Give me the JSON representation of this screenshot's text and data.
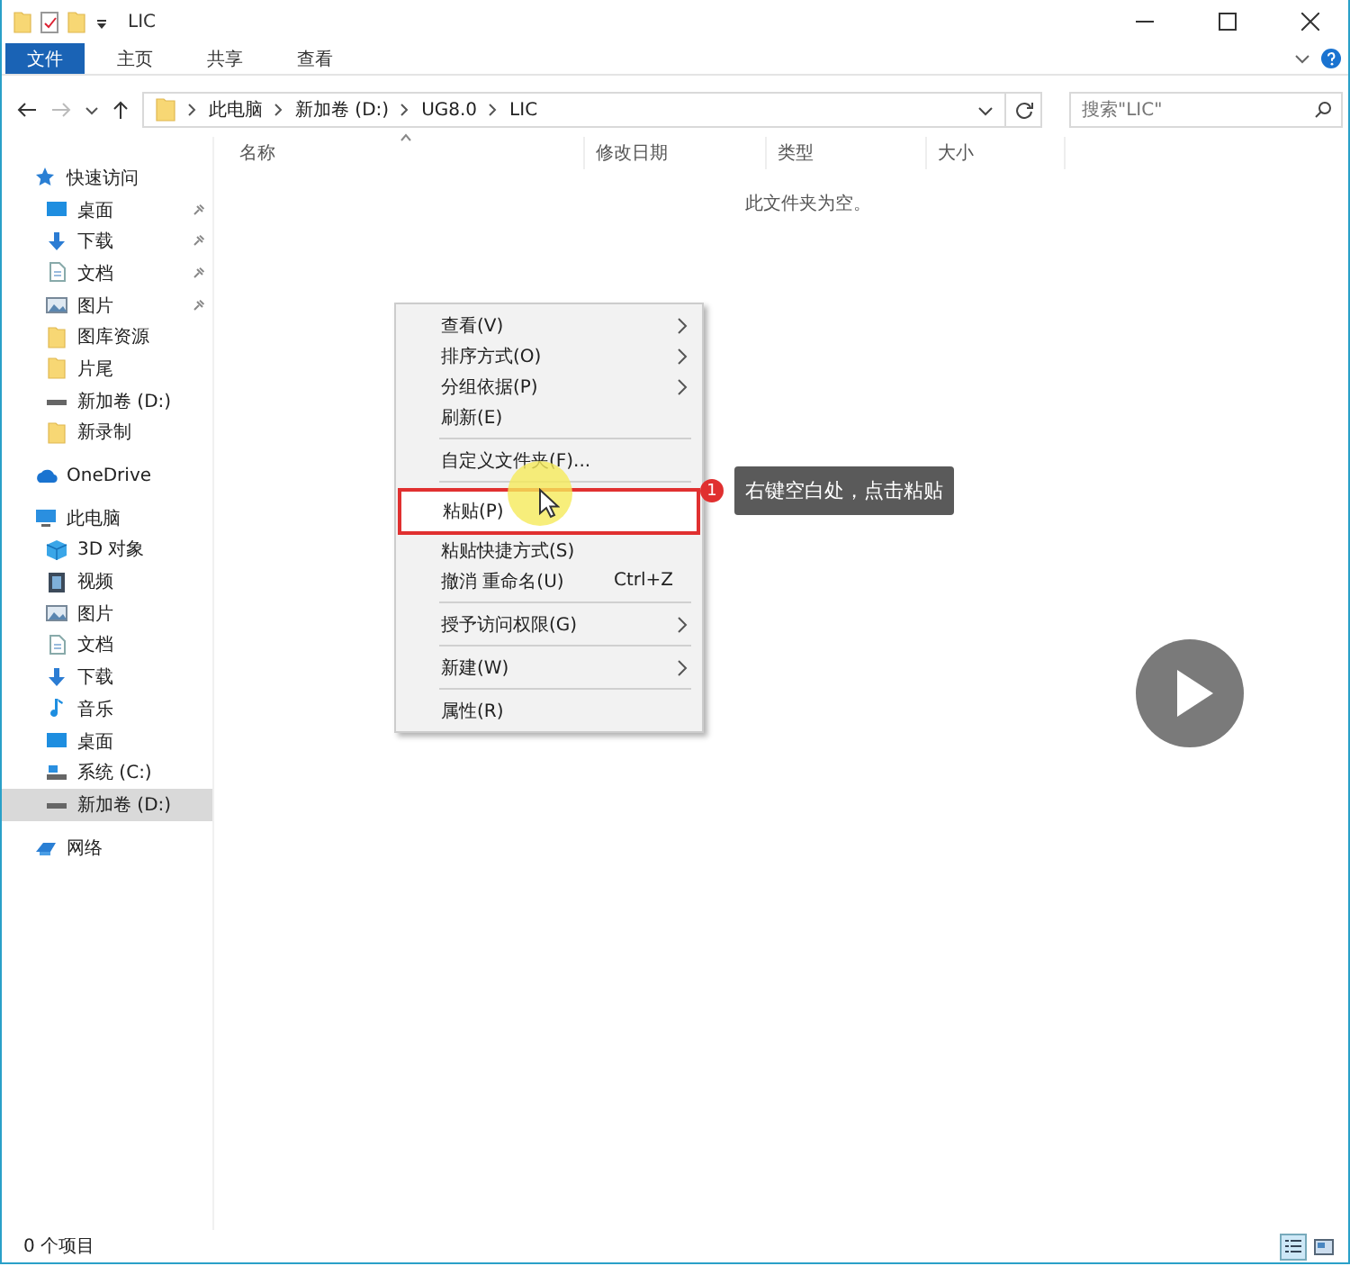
{
  "window": {
    "title": "LIC"
  },
  "ribbon": {
    "tabs": [
      {
        "label": "文件",
        "selected": true
      },
      {
        "label": "主页",
        "selected": false
      },
      {
        "label": "共享",
        "selected": false
      },
      {
        "label": "查看",
        "selected": false
      }
    ]
  },
  "address": {
    "segments": [
      "此电脑",
      "新加卷 (D:)",
      "UG8.0",
      "LIC"
    ]
  },
  "search": {
    "placeholder": "搜索\"LIC\""
  },
  "columns": [
    "名称",
    "修改日期",
    "类型",
    "大小"
  ],
  "empty_message": "此文件夹为空。",
  "sidebar": {
    "groups": [
      {
        "label": "快速访问",
        "kind": "star",
        "children": [
          {
            "label": "桌面",
            "kind": "desktop",
            "pinned": true,
            "selected": false
          },
          {
            "label": "下载",
            "kind": "download",
            "pinned": true,
            "selected": false
          },
          {
            "label": "文档",
            "kind": "document",
            "pinned": true,
            "selected": false
          },
          {
            "label": "图片",
            "kind": "pictures",
            "pinned": true,
            "selected": false
          },
          {
            "label": "图库资源",
            "kind": "folder",
            "pinned": false,
            "selected": false
          },
          {
            "label": "片尾",
            "kind": "folder",
            "pinned": false,
            "selected": false
          },
          {
            "label": "新加卷 (D:)",
            "kind": "drive",
            "pinned": false,
            "selected": false
          },
          {
            "label": "新录制",
            "kind": "folder",
            "pinned": false,
            "selected": false
          }
        ]
      },
      {
        "label": "OneDrive",
        "kind": "cloud"
      },
      {
        "label": "此电脑",
        "kind": "computer",
        "children": [
          {
            "label": "3D 对象",
            "kind": "cube",
            "pinned": false,
            "selected": false
          },
          {
            "label": "视频",
            "kind": "video",
            "pinned": false,
            "selected": false
          },
          {
            "label": "图片",
            "kind": "pictures",
            "pinned": false,
            "selected": false
          },
          {
            "label": "文档",
            "kind": "document",
            "pinned": false,
            "selected": false
          },
          {
            "label": "下载",
            "kind": "download",
            "pinned": false,
            "selected": false
          },
          {
            "label": "音乐",
            "kind": "music",
            "pinned": false,
            "selected": false
          },
          {
            "label": "桌面",
            "kind": "desktop",
            "pinned": false,
            "selected": false
          },
          {
            "label": "系统 (C:)",
            "kind": "system-drive",
            "pinned": false,
            "selected": false
          },
          {
            "label": "新加卷 (D:)",
            "kind": "drive",
            "pinned": false,
            "selected": true
          }
        ]
      },
      {
        "label": "网络",
        "kind": "network"
      }
    ]
  },
  "context_menu": {
    "items": [
      {
        "kind": "item",
        "label": "查看(V)",
        "submenu": true
      },
      {
        "kind": "item",
        "label": "排序方式(O)",
        "submenu": true
      },
      {
        "kind": "item",
        "label": "分组依据(P)",
        "submenu": true
      },
      {
        "kind": "item",
        "label": "刷新(E)",
        "submenu": false
      },
      {
        "kind": "separator"
      },
      {
        "kind": "item",
        "label": "自定义文件夹(F)...",
        "submenu": false
      },
      {
        "kind": "separator"
      },
      {
        "kind": "item",
        "label": "粘贴(P)",
        "submenu": false,
        "highlighted": true
      },
      {
        "kind": "item",
        "label": "粘贴快捷方式(S)",
        "submenu": false
      },
      {
        "kind": "item",
        "label": "撤消 重命名(U)",
        "submenu": false,
        "shortcut": "Ctrl+Z"
      },
      {
        "kind": "separator"
      },
      {
        "kind": "item",
        "label": "授予访问权限(G)",
        "submenu": true
      },
      {
        "kind": "separator"
      },
      {
        "kind": "item",
        "label": "新建(W)",
        "submenu": true
      },
      {
        "kind": "separator"
      },
      {
        "kind": "item",
        "label": "属性(R)",
        "submenu": false
      }
    ]
  },
  "annotation": {
    "badge": "1",
    "text": "右键空白处，点击粘贴"
  },
  "status_bar": {
    "text": "0 个项目",
    "views": [
      {
        "kind": "details",
        "selected": true
      },
      {
        "kind": "tiles",
        "selected": false
      }
    ]
  }
}
